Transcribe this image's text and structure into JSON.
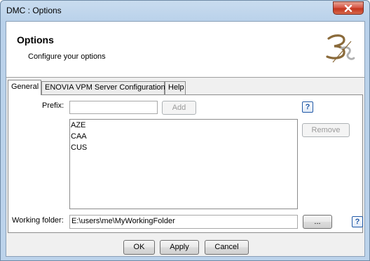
{
  "window": {
    "title": "DMC : Options"
  },
  "header": {
    "title": "Options",
    "subtitle": "Configure your options"
  },
  "tabs": [
    {
      "label": "General",
      "active": true
    },
    {
      "label": "ENOVIA VPM Server Configuration",
      "active": false
    },
    {
      "label": "Help",
      "active": false
    }
  ],
  "general": {
    "prefix_label": "Prefix:",
    "prefix_value": "",
    "add_label": "Add",
    "remove_label": "Remove",
    "prefix_list": [
      "AZE",
      "CAA",
      "CUS"
    ],
    "working_folder_label": "Working folder:",
    "working_folder_value": "E:\\users\\me\\MyWorkingFolder",
    "browse_label": "...",
    "help_glyph": "?"
  },
  "footer": {
    "ok_label": "OK",
    "apply_label": "Apply",
    "cancel_label": "Cancel"
  },
  "icons": {
    "close": "close-icon",
    "help": "help-icon",
    "logo": "3ds-logo"
  },
  "colors": {
    "close_button": "#c4361f",
    "help_icon": "#1f58a6",
    "titlebar": "#b9d1ea"
  }
}
